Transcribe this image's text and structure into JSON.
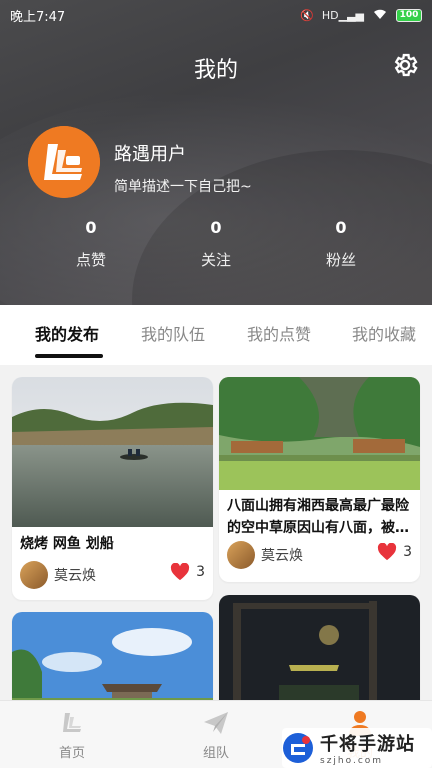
{
  "status_bar": {
    "time": "晚上7:47",
    "signal_text": "HD",
    "battery": "100"
  },
  "header": {
    "title": "我的",
    "settings_icon": "gear-icon"
  },
  "profile": {
    "name": "路遇用户",
    "bio": "简单描述一下自己把~",
    "stats": [
      {
        "value": "0",
        "label": "点赞"
      },
      {
        "value": "0",
        "label": "关注"
      },
      {
        "value": "0",
        "label": "粉丝"
      }
    ]
  },
  "tabs": [
    {
      "label": "我的发布",
      "active": true
    },
    {
      "label": "我的队伍",
      "active": false
    },
    {
      "label": "我的点赞",
      "active": false
    },
    {
      "label": "我的收藏",
      "active": false
    }
  ],
  "posts": [
    {
      "title": "烧烤  网鱼 划船",
      "author": "莫云焕",
      "likes": "3"
    },
    {
      "title": "八面山拥有湘西最高最广最险的空中草原因山有八面，被…",
      "author": "莫云焕",
      "likes": "3"
    },
    {
      "title": "",
      "author": "",
      "likes": ""
    },
    {
      "title": "",
      "author": "",
      "likes": ""
    }
  ],
  "bottom_nav": [
    {
      "label": "首页",
      "icon": "home-logo-icon"
    },
    {
      "label": "组队",
      "icon": "paper-plane-icon"
    },
    {
      "label": "我的",
      "icon": "user-icon"
    }
  ],
  "watermark": {
    "text": "千将手游站",
    "sub": "szjho.com"
  },
  "colors": {
    "accent": "#ef7a22",
    "like_red": "#e8333b",
    "header_bg": "#444446"
  }
}
